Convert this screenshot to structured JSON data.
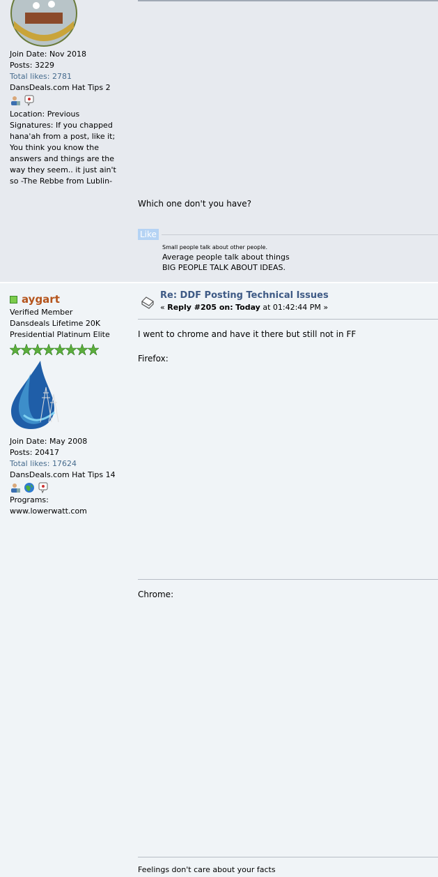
{
  "post1": {
    "poster": {
      "join_date": "Join Date: Nov 2018",
      "posts": "Posts: 3229",
      "total_likes": "Total likes: 2781",
      "hat_tips": "DansDeals.com Hat Tips 2",
      "location": "Location: Previous Signatures: If you chapped hana'ah from a post, like it; You think you know the answers and things are the way they seem.. it just ain't so -The Rebbe from Lublin-"
    },
    "message": "Which one don't you have?",
    "like_label": "Like",
    "signature": {
      "line1": "Small people talk about other people.",
      "line2": "Average people talk about things",
      "line3": "BIG PEOPLE TALK ABOUT IDEAS."
    }
  },
  "post2": {
    "poster": {
      "username": "aygart",
      "title1": "Verified Member",
      "title2": "Dansdeals Lifetime 20K",
      "title3": "Presidential Platinum Elite",
      "join_date": "Join Date: May 2008",
      "posts": "Posts: 20417",
      "total_likes": "Total likes: 17624",
      "hat_tips": "DansDeals.com Hat Tips 14",
      "programs_label": "Programs:",
      "programs_value": "www.lowerwatt.com"
    },
    "subject": "Re: DDF Posting Technical Issues",
    "reply_prefix": "«",
    "reply_label": "Reply #205 on:",
    "reply_day": "Today",
    "reply_time": "at 01:42:44 PM »",
    "message_line1": "I went to chrome and have it there but still not in FF",
    "firefox_label": "Firefox:",
    "chrome_label": "Chrome:",
    "signature": "Feelings don't care about your facts"
  },
  "colors": {
    "username": "#b5541c",
    "link": "#476c8e",
    "subject": "#3e5a85",
    "like_button": "#b5d3f4"
  },
  "icons": [
    "profile-icon",
    "pm-icon",
    "website-icon",
    "star-icon",
    "online-indicator-icon",
    "post-xx-icon"
  ]
}
